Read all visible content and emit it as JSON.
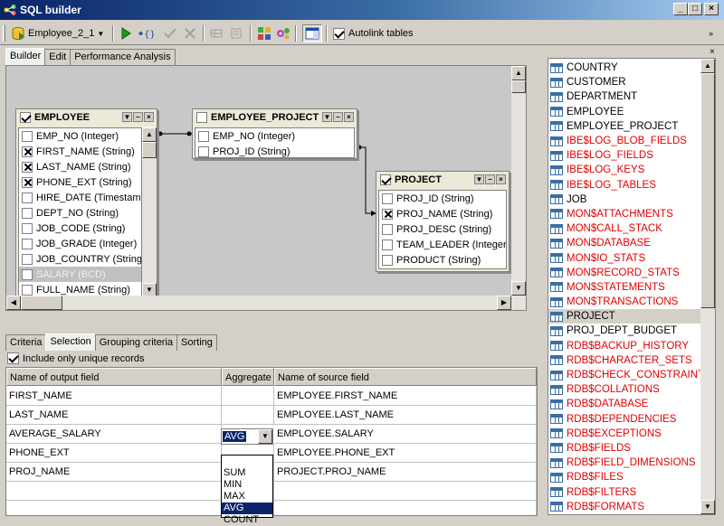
{
  "window": {
    "title": "SQL builder"
  },
  "toolbar": {
    "connection": "Employee_2_1",
    "autolink_label": "Autolink tables",
    "autolink_checked": true
  },
  "builder_tabs": [
    {
      "label": "Builder",
      "active": true
    },
    {
      "label": "Edit",
      "active": false
    },
    {
      "label": "Performance Analysis",
      "active": false
    }
  ],
  "tables": {
    "employee": {
      "name": "EMPLOYEE",
      "checked": true,
      "fields": [
        {
          "label": "EMP_NO (Integer)",
          "checked": false
        },
        {
          "label": "FIRST_NAME (String)",
          "checked": true
        },
        {
          "label": "LAST_NAME (String)",
          "checked": true
        },
        {
          "label": "PHONE_EXT (String)",
          "checked": true
        },
        {
          "label": "HIRE_DATE (Timestamp)",
          "checked": false
        },
        {
          "label": "DEPT_NO (String)",
          "checked": false
        },
        {
          "label": "JOB_CODE (String)",
          "checked": false
        },
        {
          "label": "JOB_GRADE (Integer)",
          "checked": false
        },
        {
          "label": "JOB_COUNTRY (String)",
          "checked": false
        },
        {
          "label": "SALARY (BCD)",
          "checked": false,
          "selected": true
        },
        {
          "label": "FULL_NAME (String)",
          "checked": false
        }
      ]
    },
    "employee_project": {
      "name": "EMPLOYEE_PROJECT",
      "checked": false,
      "fields": [
        {
          "label": "EMP_NO (Integer)",
          "checked": false
        },
        {
          "label": "PROJ_ID (String)",
          "checked": false
        }
      ]
    },
    "project": {
      "name": "PROJECT",
      "checked": true,
      "fields": [
        {
          "label": "PROJ_ID (String)",
          "checked": false
        },
        {
          "label": "PROJ_NAME (String)",
          "checked": true
        },
        {
          "label": "PROJ_DESC (String)",
          "checked": false
        },
        {
          "label": "TEAM_LEADER (Integer)",
          "checked": false
        },
        {
          "label": "PRODUCT (String)",
          "checked": false
        }
      ]
    }
  },
  "criteria_tabs": [
    {
      "label": "Criteria",
      "active": false
    },
    {
      "label": "Selection",
      "active": true
    },
    {
      "label": "Grouping criteria",
      "active": false
    },
    {
      "label": "Sorting",
      "active": false
    }
  ],
  "unique_records": {
    "label": "Include only unique records",
    "checked": true
  },
  "grid": {
    "headers": [
      "Name of output field",
      "Aggregate",
      "Name of source field"
    ],
    "rows": [
      {
        "output": "FIRST_NAME",
        "aggregate": "",
        "source": "EMPLOYEE.FIRST_NAME"
      },
      {
        "output": "LAST_NAME",
        "aggregate": "",
        "source": "EMPLOYEE.LAST_NAME"
      },
      {
        "output": "AVERAGE_SALARY",
        "aggregate": "AVG",
        "source": "EMPLOYEE.SALARY"
      },
      {
        "output": "PHONE_EXT",
        "aggregate": "",
        "source": "EMPLOYEE.PHONE_EXT"
      },
      {
        "output": "PROJ_NAME",
        "aggregate": "",
        "source": "PROJECT.PROJ_NAME"
      }
    ]
  },
  "aggregate_dropdown": {
    "value": "AVG",
    "options": [
      "",
      "SUM",
      "MIN",
      "MAX",
      "AVG",
      "COUNT"
    ]
  },
  "table_list": {
    "items": [
      {
        "name": "COUNTRY",
        "system": false
      },
      {
        "name": "CUSTOMER",
        "system": false
      },
      {
        "name": "DEPARTMENT",
        "system": false
      },
      {
        "name": "EMPLOYEE",
        "system": false
      },
      {
        "name": "EMPLOYEE_PROJECT",
        "system": false
      },
      {
        "name": "IBE$LOG_BLOB_FIELDS",
        "system": true
      },
      {
        "name": "IBE$LOG_FIELDS",
        "system": true
      },
      {
        "name": "IBE$LOG_KEYS",
        "system": true
      },
      {
        "name": "IBE$LOG_TABLES",
        "system": true
      },
      {
        "name": "JOB",
        "system": false
      },
      {
        "name": "MON$ATTACHMENTS",
        "system": true
      },
      {
        "name": "MON$CALL_STACK",
        "system": true
      },
      {
        "name": "MON$DATABASE",
        "system": true
      },
      {
        "name": "MON$IO_STATS",
        "system": true
      },
      {
        "name": "MON$RECORD_STATS",
        "system": true
      },
      {
        "name": "MON$STATEMENTS",
        "system": true
      },
      {
        "name": "MON$TRANSACTIONS",
        "system": true
      },
      {
        "name": "PROJECT",
        "system": false,
        "highlighted": true
      },
      {
        "name": "PROJ_DEPT_BUDGET",
        "system": false
      },
      {
        "name": "RDB$BACKUP_HISTORY",
        "system": true
      },
      {
        "name": "RDB$CHARACTER_SETS",
        "system": true
      },
      {
        "name": "RDB$CHECK_CONSTRAINTS",
        "system": true
      },
      {
        "name": "RDB$COLLATIONS",
        "system": true
      },
      {
        "name": "RDB$DATABASE",
        "system": true
      },
      {
        "name": "RDB$DEPENDENCIES",
        "system": true
      },
      {
        "name": "RDB$EXCEPTIONS",
        "system": true
      },
      {
        "name": "RDB$FIELDS",
        "system": true
      },
      {
        "name": "RDB$FIELD_DIMENSIONS",
        "system": true
      },
      {
        "name": "RDB$FILES",
        "system": true
      },
      {
        "name": "RDB$FILTERS",
        "system": true
      },
      {
        "name": "RDB$FORMATS",
        "system": true
      }
    ]
  },
  "colors": {
    "system_table": "#e00000",
    "selection": "#0a246a",
    "title_start": "#0a246a"
  }
}
